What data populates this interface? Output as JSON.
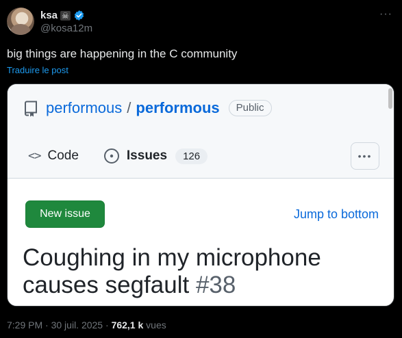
{
  "author": {
    "display_name": "ksa",
    "name_emoji": "☠",
    "handle": "@kosa12m"
  },
  "more_icon": "···",
  "tweet": {
    "text": "big things are happening in the C community",
    "translate_label": "Traduire le post"
  },
  "github": {
    "owner": "performous",
    "separator": "/",
    "repo": "performous",
    "visibility": "Public",
    "tabs": [
      {
        "icon": "<>",
        "label": "Code"
      },
      {
        "icon": "issue-opened-icon",
        "label": "Issues",
        "count": "126"
      }
    ],
    "kebab": "•••",
    "new_issue_label": "New issue",
    "jump_label": "Jump to bottom",
    "issue_title": "Coughing in my microphone causes segfault",
    "issue_number": "#38"
  },
  "meta": {
    "time": "7:29 PM",
    "date": "30 juil. 2025",
    "sep": "·",
    "views_count": "762,1 k",
    "views_label": "vues"
  },
  "colors": {
    "background": "#000000",
    "link_blue": "#1d9bf0",
    "github_blue": "#0969da",
    "github_green": "#1f883d"
  }
}
